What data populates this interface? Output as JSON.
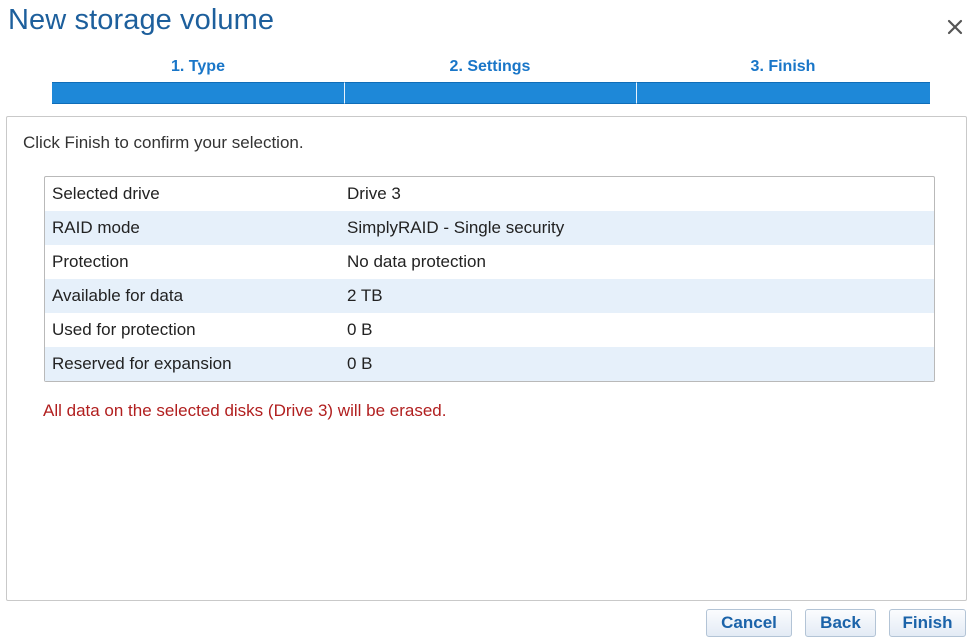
{
  "dialog": {
    "title": "New storage volume",
    "close_icon": "close-icon"
  },
  "steps": [
    {
      "label": "1. Type"
    },
    {
      "label": "2. Settings"
    },
    {
      "label": "3. Finish"
    }
  ],
  "content": {
    "instruction": "Click Finish to confirm your selection.",
    "rows": [
      {
        "label": "Selected drive",
        "value": "Drive 3"
      },
      {
        "label": "RAID mode",
        "value": "SimplyRAID - Single security"
      },
      {
        "label": "Protection",
        "value": "No data protection"
      },
      {
        "label": "Available for data",
        "value": "2 TB"
      },
      {
        "label": "Used for protection",
        "value": "0 B"
      },
      {
        "label": "Reserved for expansion",
        "value": "0 B"
      }
    ],
    "warning": "All data on the selected disks (Drive 3) will be erased."
  },
  "buttons": {
    "cancel": "Cancel",
    "back": "Back",
    "finish": "Finish"
  },
  "colors": {
    "title": "#1d5f9c",
    "step_bar": "#1e88d8",
    "step_label": "#1976c8",
    "row_alt": "#e6f0fa",
    "warning": "#b11f1f",
    "button_text": "#1b63a9"
  }
}
